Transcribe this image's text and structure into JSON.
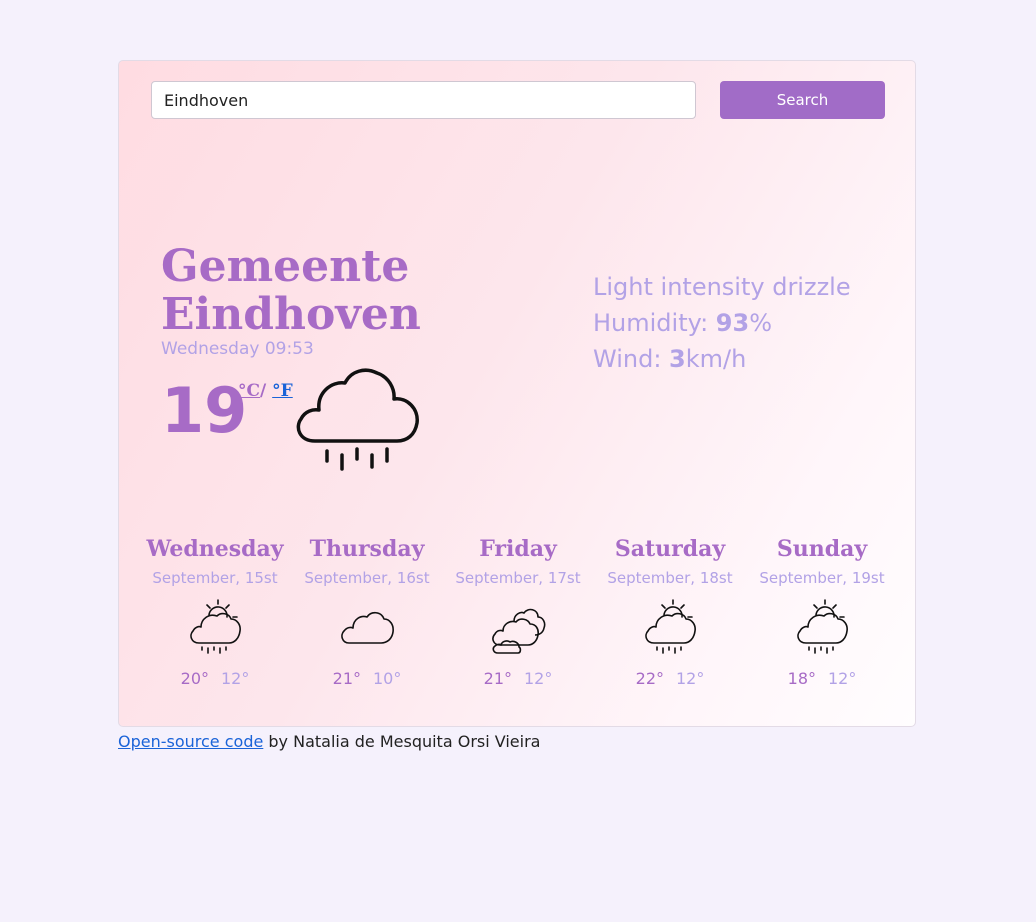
{
  "search": {
    "value": "Eindhoven",
    "button_label": "Search"
  },
  "current": {
    "city_line1": "Gemeente",
    "city_line2": "Eindhoven",
    "datetime": "Wednesday 09:53",
    "temperature": "19",
    "unit_c": "°C",
    "unit_sep": "/",
    "unit_f": "°F",
    "icon": "cloud-rain-icon",
    "description": "Light intensity drizzle",
    "humidity_label": "Humidity: ",
    "humidity_value": "93",
    "humidity_unit": "%",
    "wind_label": "Wind: ",
    "wind_value": "3",
    "wind_unit": "km/h"
  },
  "forecast": [
    {
      "day": "Wednesday",
      "date": "September, 15st",
      "icon": "sun-cloud-rain-icon",
      "max": "20°",
      "min": "12°"
    },
    {
      "day": "Thursday",
      "date": "September, 16st",
      "icon": "cloud-icon",
      "max": "21°",
      "min": "10°"
    },
    {
      "day": "Friday",
      "date": "September, 17st",
      "icon": "clouds-icon",
      "max": "21°",
      "min": "12°"
    },
    {
      "day": "Saturday",
      "date": "September, 18st",
      "icon": "sun-cloud-rain-icon",
      "max": "22°",
      "min": "12°"
    },
    {
      "day": "Sunday",
      "date": "September, 19st",
      "icon": "sun-cloud-rain-icon",
      "max": "18°",
      "min": "12°"
    }
  ],
  "footer": {
    "link_text": "Open-source code",
    "text": " by Natalia de Mesquita Orsi Vieira"
  },
  "colors": {
    "accent": "#a76bc6",
    "muted": "#b2a2e6",
    "button": "#a16cc7",
    "link": "#1a63d8"
  }
}
